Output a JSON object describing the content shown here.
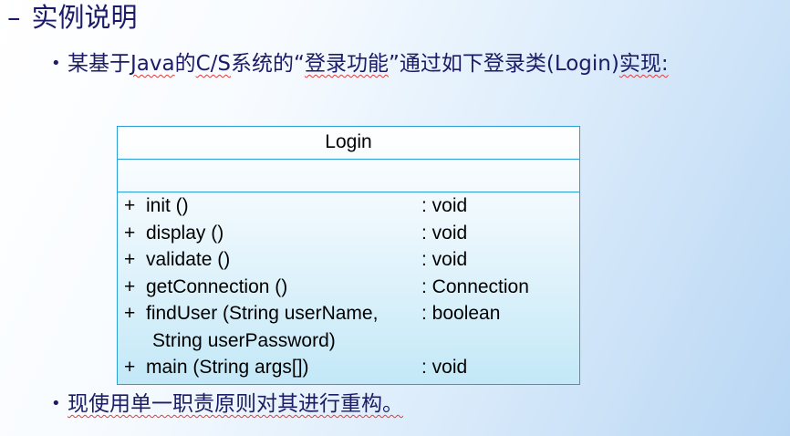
{
  "heading": {
    "dash": "–",
    "text": "实例说明"
  },
  "bullets": [
    {
      "dot": "•",
      "segments": [
        {
          "text": "某基于",
          "squiggle": false
        },
        {
          "text": "Java",
          "squiggle": true
        },
        {
          "text": "的",
          "squiggle": false
        },
        {
          "text": "C/S",
          "squiggle": true
        },
        {
          "text": "系统的“",
          "squiggle": false
        },
        {
          "text": "登录功能",
          "squiggle": true
        },
        {
          "text": "”通过如下登录类(Login)",
          "squiggle": false
        },
        {
          "text": "实现:",
          "squiggle": true
        }
      ]
    },
    {
      "dot": "•",
      "segments": [
        {
          "text": "现使用单一职责原则对其进行重构。",
          "squiggle": true
        }
      ]
    }
  ],
  "uml_class": {
    "name": "Login",
    "attributes": [],
    "operations": [
      {
        "visibility": "+",
        "signature": "init ()",
        "return_type": ": void"
      },
      {
        "visibility": "+",
        "signature": "display ()",
        "return_type": ": void"
      },
      {
        "visibility": "+",
        "signature": "validate ()",
        "return_type": ": void"
      },
      {
        "visibility": "+",
        "signature": "getConnection ()",
        "return_type": ": Connection"
      },
      {
        "visibility": "+",
        "signature": "findUser (String userName,",
        "return_type": ": boolean"
      },
      {
        "visibility": "",
        "signature": "String userPassword)",
        "return_type": ""
      },
      {
        "visibility": "+",
        "signature": "main (String args[])",
        "return_type": ": void"
      }
    ]
  }
}
